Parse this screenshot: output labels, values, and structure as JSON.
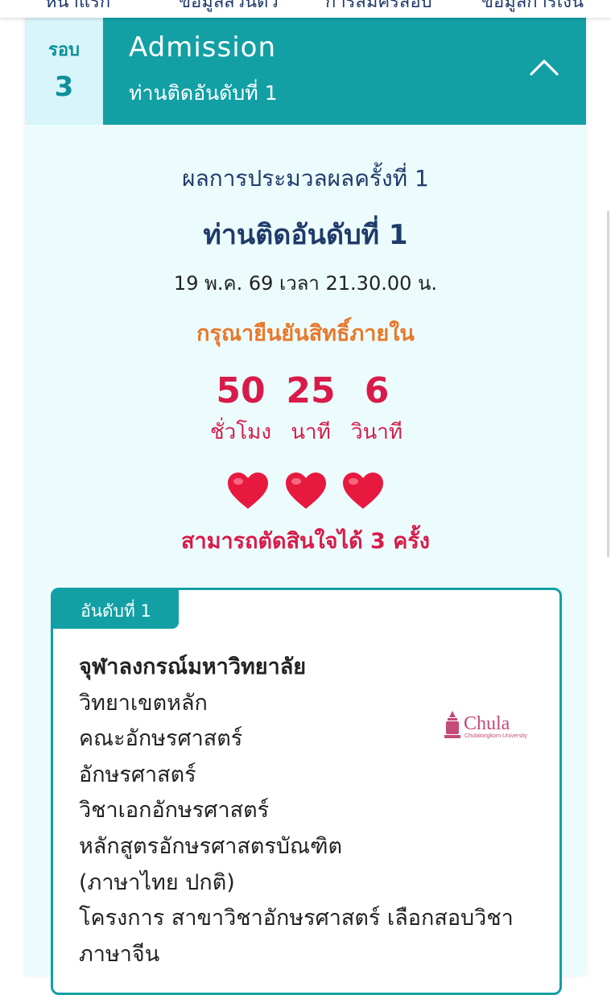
{
  "nav": {
    "items": [
      "หน้าแรก",
      "ข้อมูลส่วนตัว",
      "การสมัครสอบ",
      "ข้อมูลการเงิน"
    ]
  },
  "round": {
    "label": "รอบ",
    "number": "3"
  },
  "header": {
    "title": "Admission",
    "subtitle": "ท่านติดอันดับที่ 1"
  },
  "result": {
    "title": "ผลการประมวลผลครั้งที่ 1",
    "rank": "ท่านติดอันดับที่ 1",
    "datetime": "19 พ.ค. 69 เวลา 21.30.00 น.",
    "confirm": "กรุณายืนยันสิทธิ์ภายใน"
  },
  "countdown": {
    "hours": "50",
    "hours_label": "ชั่วโมง",
    "minutes": "25",
    "minutes_label": "นาที",
    "seconds": "6",
    "seconds_label": "วินาที"
  },
  "hearts": {
    "count": 3,
    "color": "#e8193f"
  },
  "chances": "สามารถตัดสินใจได้ 3 ครั้ง",
  "choice": {
    "tab": "อันดับที่ 1",
    "university": "จุฬาลงกรณ์มหาวิทยาลัย",
    "campus": "วิทยาเขตหลัก",
    "faculty": "คณะอักษรศาสตร์",
    "field": "อักษรศาสตร์",
    "major": "วิชาเอกอักษรศาสตร์",
    "program": "หลักสูตรอักษรศาสตรบัณฑิต",
    "program_type": "(ภาษาไทย ปกติ)",
    "project": "โครงการ สาขาวิชาอักษรศาสตร์ เลือกสอบวิชา",
    "project_cont": "ภาษาจีน",
    "logo_text": "Chula",
    "logo_subtext": "Chulalongkorn University"
  },
  "colors": {
    "teal": "#12a0a5",
    "navy": "#1f3a6a",
    "orange": "#e8782a",
    "red": "#d81b4a",
    "logo_pink": "#c44a78"
  },
  "icons": [
    "chevron-up-icon",
    "heart-icon",
    "chula-logo"
  ]
}
